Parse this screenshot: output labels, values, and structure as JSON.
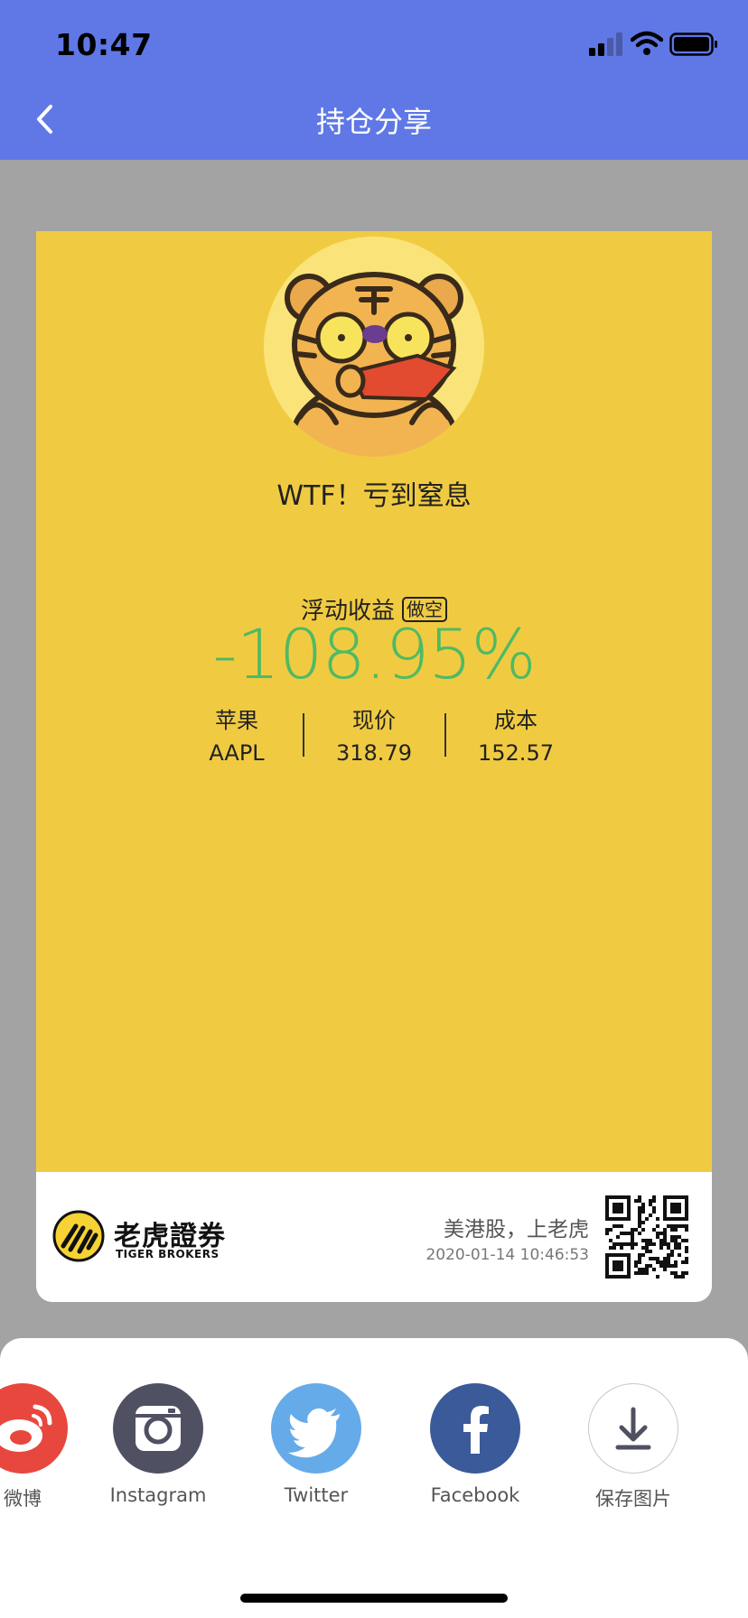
{
  "status_bar": {
    "time": "10:47"
  },
  "nav": {
    "title": "持仓分享"
  },
  "card": {
    "title": "WTF！亏到窒息",
    "label": "浮动收益",
    "tag": "做空",
    "percent": "-108.95%",
    "stats": [
      {
        "label": "苹果",
        "value": "AAPL"
      },
      {
        "label": "现价",
        "value": "318.79"
      },
      {
        "label": "成本",
        "value": "152.57"
      }
    ],
    "brand_cn": "老虎證券",
    "brand_en": "TIGER BROKERS",
    "slogan": "美港股，上老虎",
    "timestamp": "2020-01-14 10:46:53"
  },
  "share": [
    {
      "label": "微博",
      "icon": "weibo-icon",
      "color": "#e8473e"
    },
    {
      "label": "Instagram",
      "icon": "instagram-icon",
      "color": "#4f5163"
    },
    {
      "label": "Twitter",
      "icon": "twitter-icon",
      "color": "#65abe9"
    },
    {
      "label": "Facebook",
      "icon": "facebook-icon",
      "color": "#3b5a9a"
    },
    {
      "label": "保存图片",
      "icon": "download-icon",
      "color": "#ffffff"
    }
  ],
  "colors": {
    "nav": "#5f78e6",
    "card": "#f0cb42",
    "loss": "#4fba63"
  }
}
